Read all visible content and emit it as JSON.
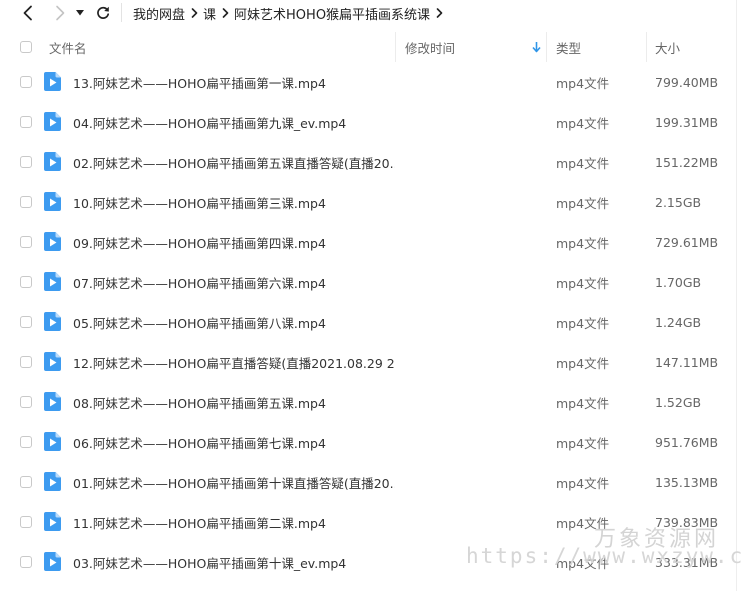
{
  "breadcrumb": [
    "我的网盘",
    "课",
    "阿妹艺术HOHO猴扁平插画系统课"
  ],
  "columns": {
    "name": "文件名",
    "modified": "修改时间",
    "type": "类型",
    "size": "大小"
  },
  "files": [
    {
      "name": "13.阿妹艺术——HOHO扁平插画第一课.mp4",
      "type": "mp4文件",
      "size": "799.40MB"
    },
    {
      "name": "04.阿妹艺术——HOHO扁平插画第九课_ev.mp4",
      "type": "mp4文件",
      "size": "199.31MB"
    },
    {
      "name": "02.阿妹艺术——HOHO扁平插画第五课直播答疑(直播20...",
      "type": "mp4文件",
      "size": "151.22MB"
    },
    {
      "name": "10.阿妹艺术——HOHO扁平插画第三课.mp4",
      "type": "mp4文件",
      "size": "2.15GB"
    },
    {
      "name": "09.阿妹艺术——HOHO扁平插画第四课.mp4",
      "type": "mp4文件",
      "size": "729.61MB"
    },
    {
      "name": "07.阿妹艺术——HOHO扁平插画第六课.mp4",
      "type": "mp4文件",
      "size": "1.70GB"
    },
    {
      "name": "05.阿妹艺术——HOHO扁平插画第八课.mp4",
      "type": "mp4文件",
      "size": "1.24GB"
    },
    {
      "name": "12.阿妹艺术——HOHO扁平直播答疑(直播2021.08.29 2...",
      "type": "mp4文件",
      "size": "147.11MB"
    },
    {
      "name": "08.阿妹艺术——HOHO扁平插画第五课.mp4",
      "type": "mp4文件",
      "size": "1.52GB"
    },
    {
      "name": "06.阿妹艺术——HOHO扁平插画第七课.mp4",
      "type": "mp4文件",
      "size": "951.76MB"
    },
    {
      "name": "01.阿妹艺术——HOHO扁平插画第十课直播答疑(直播20...",
      "type": "mp4文件",
      "size": "135.13MB"
    },
    {
      "name": "11.阿妹艺术——HOHO扁平插画第二课.mp4",
      "type": "mp4文件",
      "size": "739.83MB"
    },
    {
      "name": "03.阿妹艺术——HOHO扁平插画第十课_ev.mp4",
      "type": "mp4文件",
      "size": "333.31MB"
    }
  ],
  "watermark": {
    "text": "万象资源网",
    "url": "https://www.wxzyw.cn"
  },
  "colors": {
    "accent": "#2f95e8",
    "icon": "#3d9bf0",
    "text": "#333333",
    "muted": "#666666"
  },
  "icons": {
    "back": "chevron-left-icon",
    "forward": "chevron-right-icon",
    "history": "caret-down-icon",
    "refresh": "refresh-icon",
    "sort": "arrow-down-icon",
    "file": "video-file-icon"
  }
}
